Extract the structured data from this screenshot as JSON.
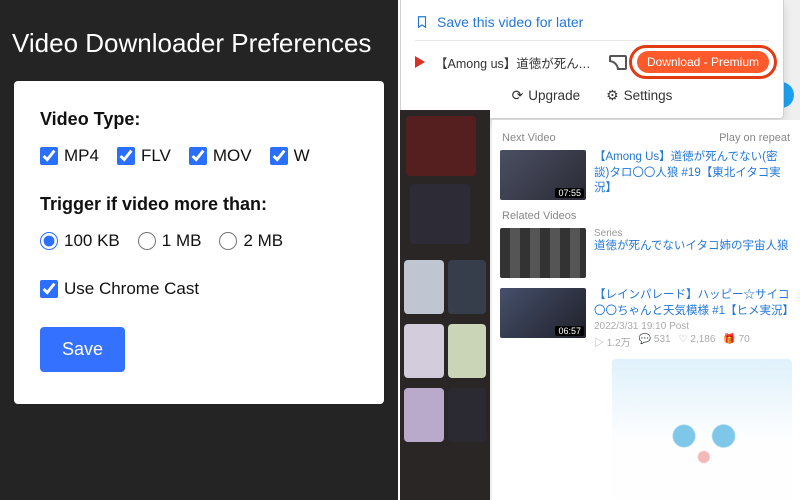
{
  "prefs": {
    "title": "Video Downloader Preferences",
    "videoTypeLabel": "Video Type:",
    "types": [
      {
        "label": "MP4",
        "checked": true
      },
      {
        "label": "FLV",
        "checked": true
      },
      {
        "label": "MOV",
        "checked": true
      },
      {
        "label": "W",
        "checked": true
      }
    ],
    "triggerLabel": "Trigger if video more than:",
    "sizes": [
      {
        "label": "100 KB",
        "selected": true
      },
      {
        "label": "1 MB",
        "selected": false
      },
      {
        "label": "2 MB",
        "selected": false
      }
    ],
    "useCast": {
      "label": "Use Chrome Cast",
      "checked": true
    },
    "saveLabel": "Save"
  },
  "popup": {
    "saveLater": "Save this video for later",
    "videoTitle": "【Among us】道徳が死んで…",
    "downloadLabel": "Download - Premium",
    "upgrade": "Upgrade",
    "settings": "Settings"
  },
  "list": {
    "nextLabel": "Next Video",
    "repeatLabel": "Play on repeat",
    "relatedLabel": "Related Videos",
    "items": [
      {
        "title": "【Among Us】道徳が死んでない(密談)タロ〇〇人狼 #19【東北イタコ実況】",
        "duration": "07:55",
        "series": ""
      },
      {
        "title": "道徳が死んでないイタコ姉の宇宙人狼",
        "duration": "",
        "series": "Series"
      },
      {
        "title": "【レインパレード】ハッピー☆サイコ〇〇ちゃんと天気模様 #1【ヒメ実況】",
        "duration": "06:57",
        "series": "",
        "date": "2022/3/31 19:10 Post",
        "views": "1.2万",
        "comments": "531",
        "mylist": "2,186",
        "gift": "70"
      }
    ]
  }
}
